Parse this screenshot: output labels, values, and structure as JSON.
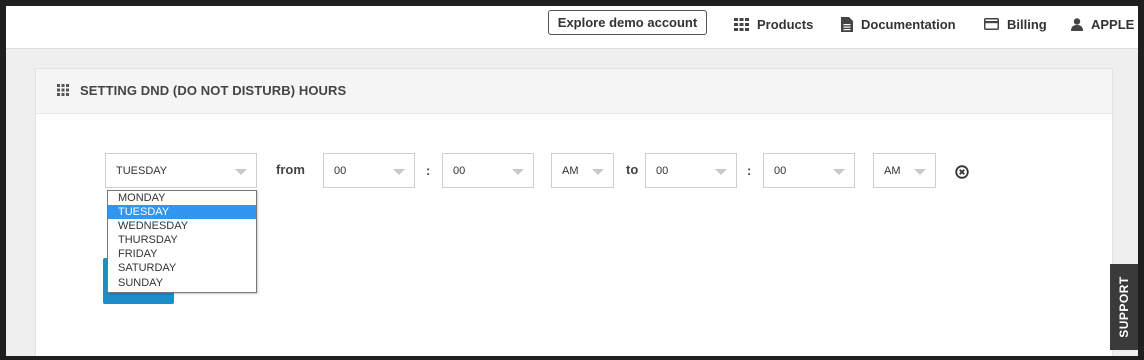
{
  "topbar": {
    "demo_button": "Explore demo account",
    "nav": [
      {
        "label": "Products",
        "icon": "grid-icon"
      },
      {
        "label": "Documentation",
        "icon": "document-icon"
      },
      {
        "label": "Billing",
        "icon": "credit-card-icon"
      },
      {
        "label": "APPLE",
        "icon": "user-icon"
      }
    ]
  },
  "panel": {
    "title": "SETTING DND (DO NOT DISTURB) HOURS",
    "day_select": {
      "value": "TUESDAY",
      "options": [
        "MONDAY",
        "TUESDAY",
        "WEDNESDAY",
        "THURSDAY",
        "FRIDAY",
        "SATURDAY",
        "SUNDAY"
      ],
      "selected_index": 1
    },
    "from_label": "from",
    "to_label": "to",
    "colon": ":",
    "from_hour": "00",
    "from_minute": "00",
    "from_ampm": "AM",
    "to_hour": "00",
    "to_minute": "00",
    "to_ampm": "AM"
  },
  "support_tab": "SUPPORT",
  "colors": {
    "accent": "#1b8ec9",
    "selected_option": "#3296f0",
    "support_bg": "#3a3a3a"
  }
}
